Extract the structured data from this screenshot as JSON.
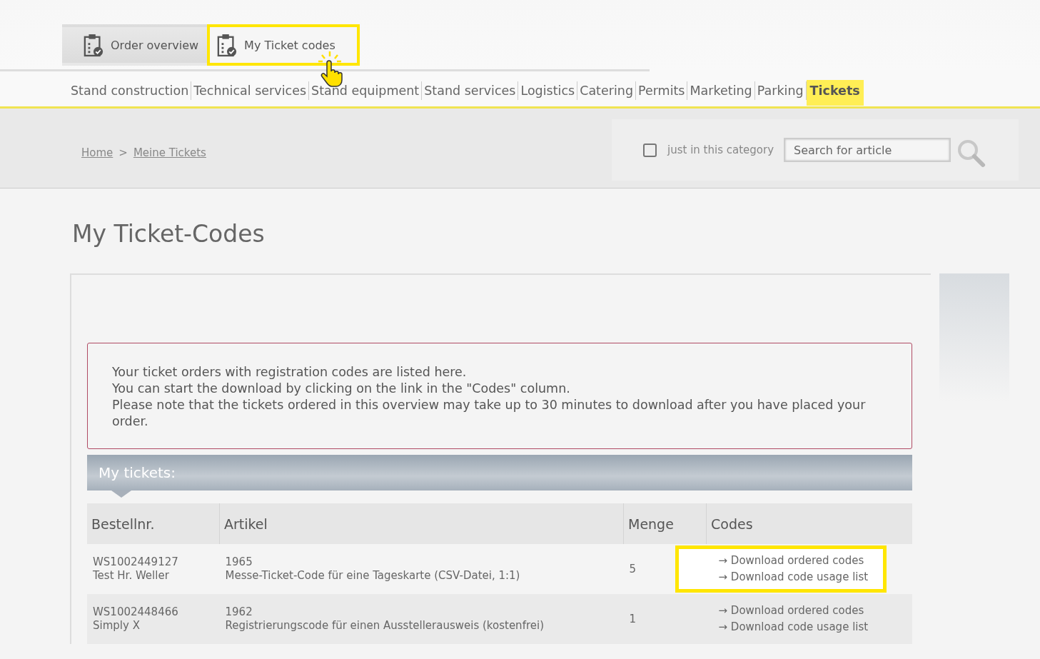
{
  "top_tabs": [
    {
      "label": "Order overview",
      "selected": false,
      "highlighted": false
    },
    {
      "label": "My Ticket codes",
      "selected": true,
      "highlighted": true
    }
  ],
  "nav": [
    {
      "label": "Stand construction",
      "selected": false
    },
    {
      "label": "Technical services",
      "selected": false
    },
    {
      "label": "Stand equipment",
      "selected": false
    },
    {
      "label": "Stand services",
      "selected": false
    },
    {
      "label": "Logistics",
      "selected": false
    },
    {
      "label": "Catering",
      "selected": false
    },
    {
      "label": "Permits",
      "selected": false
    },
    {
      "label": "Marketing",
      "selected": false
    },
    {
      "label": "Parking",
      "selected": false
    },
    {
      "label": "Tickets",
      "selected": true
    }
  ],
  "breadcrumb": [
    "Home",
    "Meine Tickets"
  ],
  "breadcrumb_separator": ">",
  "search": {
    "checkbox_label": "just in this category",
    "checked": false,
    "placeholder": "Search for article"
  },
  "title": "My Ticket-Codes",
  "notice": [
    "Your ticket orders with registration codes are listed here.",
    "You can start the download by clicking on the link in the \"Codes\" column.",
    "Please note that the tickets ordered in this overview may take up to 30 minutes to download after you have placed your order."
  ],
  "section_title": "My tickets:",
  "table": {
    "columns": [
      "Bestellnr.",
      "Artikel",
      "Menge",
      "Codes"
    ],
    "rows": [
      {
        "order": "WS1002449127",
        "customer": "Test Hr. Weller",
        "article_no": "1965",
        "article": "Messe-Ticket-Code für eine Tageskarte (CSV-Datei, 1:1)",
        "quantity": "5",
        "links": [
          "→ Download ordered codes",
          "→ Download code usage list"
        ],
        "highlighted": true
      },
      {
        "order": "WS1002448466",
        "customer": "Simply X",
        "article_no": "1962",
        "article": "Registrierungscode für einen Ausstellerausweis (kostenfrei)",
        "quantity": "1",
        "links": [
          "→ Download ordered codes",
          "→ Download code usage list"
        ],
        "highlighted": false
      }
    ]
  }
}
